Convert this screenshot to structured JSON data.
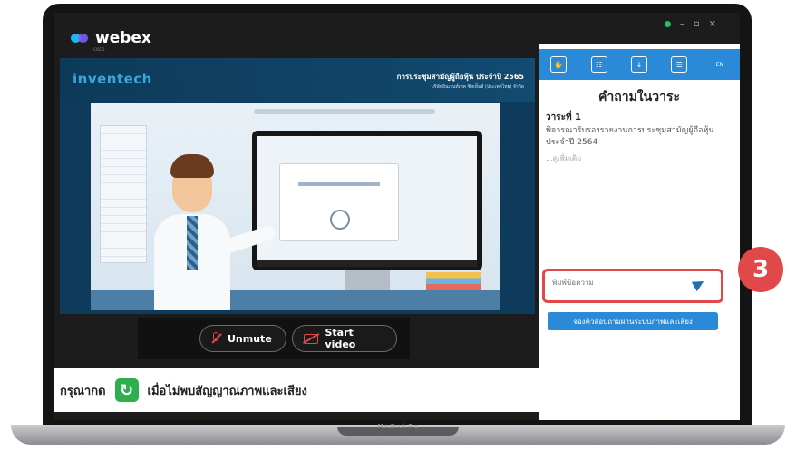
{
  "app": {
    "name": "webex",
    "sub": "CISCO",
    "laptop_model": "MacBook Pro"
  },
  "window_controls": {
    "minimize": "–",
    "maximize": "▫",
    "close": "×"
  },
  "presentation": {
    "logo": "inventech",
    "title": "การประชุมสามัญผู้ถือหุ้น ประจำปี 2565",
    "subtitle": "บริษัทอินเวนท์เทค ซิสเท็มส์ (ประเทศไทย) จำกัด"
  },
  "controls": {
    "unmute_label": "Unmute",
    "start_video_label": "Start video"
  },
  "instruction": {
    "prefix": "กรุณากด",
    "suffix": "เมื่อไม่พบสัญญาณภาพและเสียง"
  },
  "panel": {
    "tabs": [
      "hand-icon",
      "vote-icon",
      "download-icon",
      "document-icon",
      "language-icon"
    ],
    "language_label": "EN",
    "title": "คำถามในวาระ",
    "agenda_label": "วาระที่ 1",
    "agenda_desc": "พิจารณารับรองรายงานการประชุมสามัญผู้ถือหุ้น ประจำปี 2564",
    "agenda_more": "...ดูเพิ่มเติม",
    "question_placeholder": "พิมพ์ข้อความ",
    "video_question_label": "จองคิวสอบถามผ่านระบบภาพและเสียง"
  },
  "step_badge": "3",
  "colors": {
    "accent_blue": "#2a8ad8",
    "highlight_red": "#e0484a",
    "refresh_green": "#2fae4f"
  }
}
